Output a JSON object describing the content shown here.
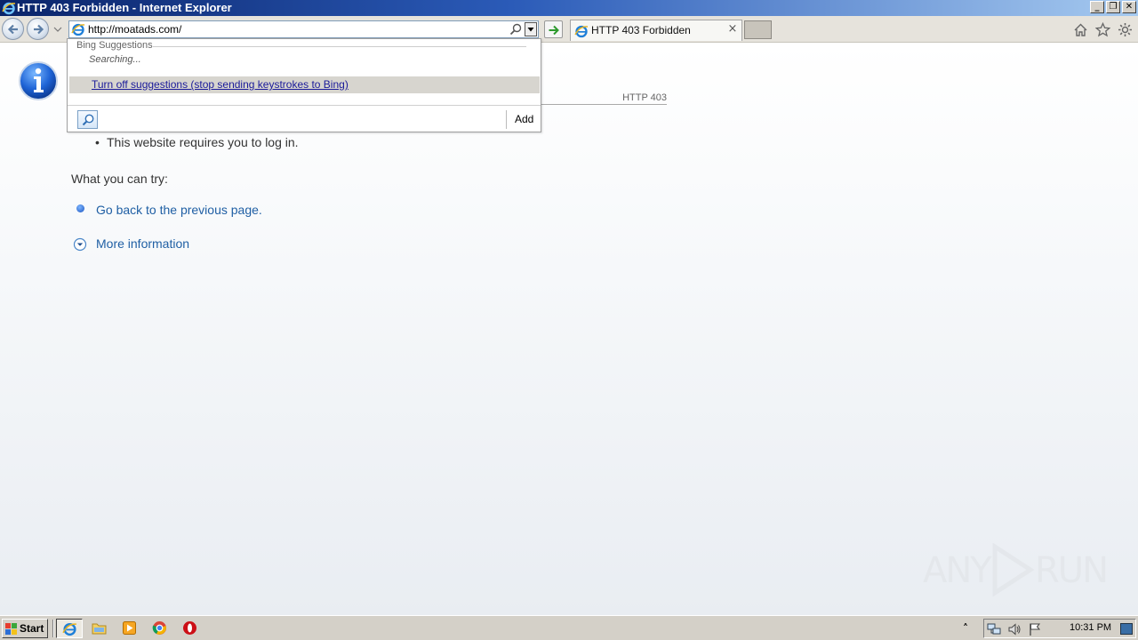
{
  "window": {
    "title": "HTTP 403 Forbidden - Internet Explorer",
    "controls": {
      "minimize": "_",
      "restore": "❐",
      "close": "✕"
    }
  },
  "navbar": {
    "address_url": "http://moatads.com/",
    "tab_title": "HTTP 403 Forbidden",
    "tab_close": "×"
  },
  "suggestions": {
    "header": "Bing Suggestions",
    "status": "Searching...",
    "turn_off_link": "Turn off suggestions (stop sending keystrokes to Bing)",
    "add_label": "Add"
  },
  "page": {
    "http_code": "HTTP 403",
    "bullet": "This website requires you to log in.",
    "bullet_mark": "•",
    "try_label": "What you can try:",
    "back_link": "Go back to the previous page.",
    "more_info": "More information"
  },
  "watermark": {
    "left": "ANY",
    "right": "RUN"
  },
  "taskbar": {
    "start_label": "Start",
    "clock": "10:31 PM",
    "tray_expand": "˄"
  }
}
